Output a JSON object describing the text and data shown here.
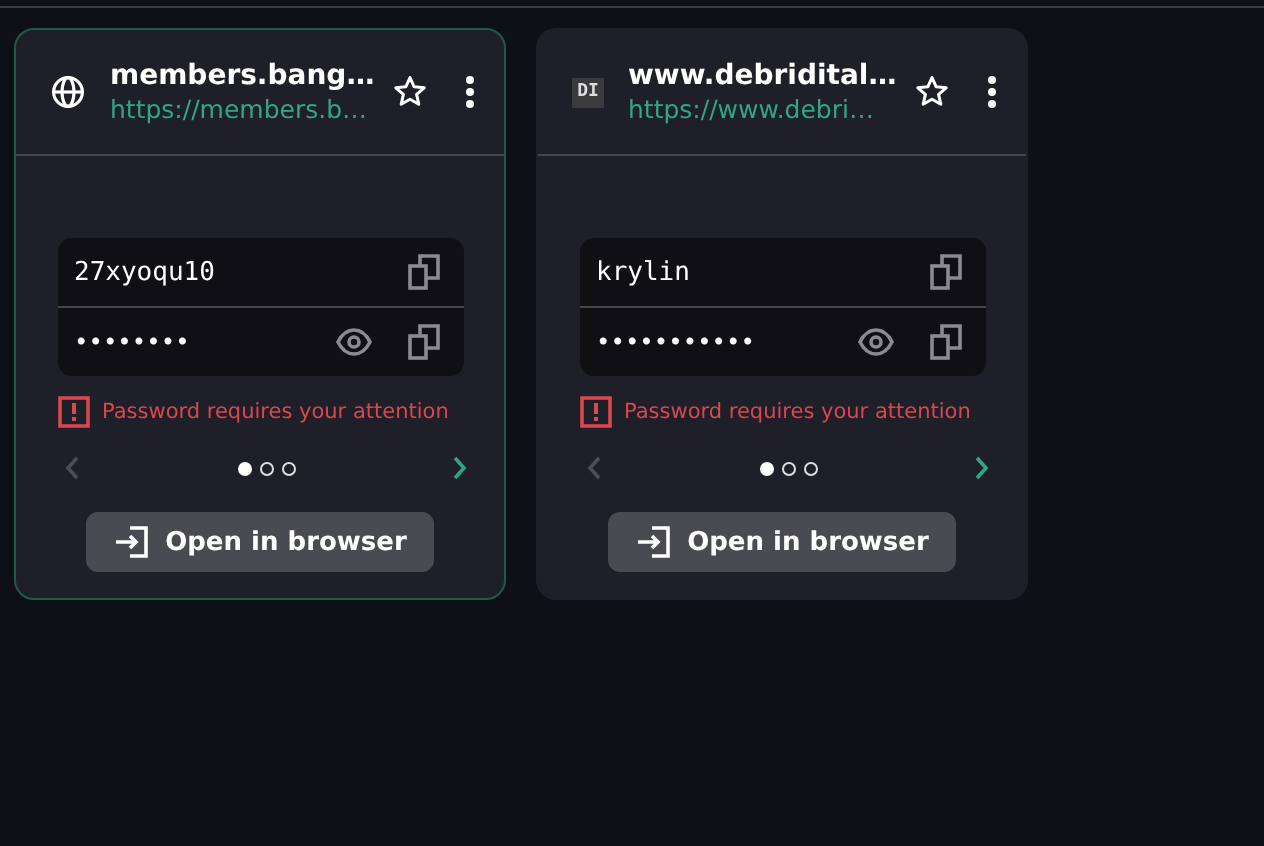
{
  "cards": [
    {
      "selected": true,
      "icon": {
        "kind": "globe"
      },
      "title": "members.bang…",
      "url": "https://members.b…",
      "username": "27xyoqu10",
      "password": "••••••••",
      "warning": "Password requires your attention",
      "pages": [
        {
          "selected": true
        },
        {
          "selected": false
        },
        {
          "selected": false
        }
      ],
      "prev_disabled": true,
      "button": "Open in browser"
    },
    {
      "selected": false,
      "icon": {
        "kind": "favicon",
        "text": "DI"
      },
      "title": "www.debridital…",
      "url": "https://www.debri…",
      "username": "krylin",
      "password": "•••••••••••",
      "warning": "Password requires your attention",
      "pages": [
        {
          "selected": true
        },
        {
          "selected": false
        },
        {
          "selected": false
        }
      ],
      "prev_disabled": true,
      "button": "Open in browser"
    }
  ]
}
